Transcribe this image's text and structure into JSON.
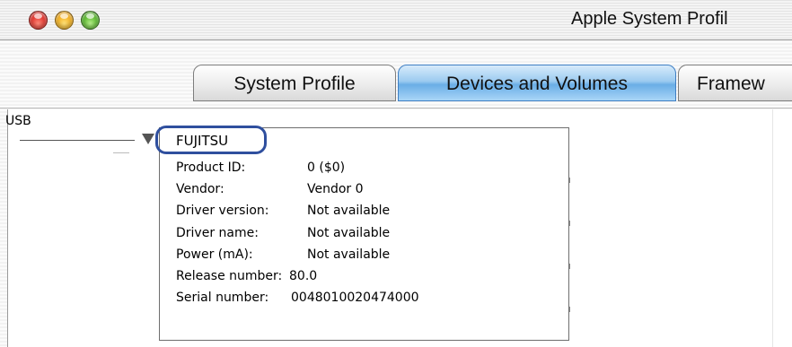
{
  "window": {
    "title": "Apple System Profil"
  },
  "tabs": [
    {
      "label": "System Profile"
    },
    {
      "label": "Devices and Volumes"
    },
    {
      "label": "Framew"
    }
  ],
  "tree": {
    "bus_label": "USB",
    "device": {
      "name": "FUJITSU",
      "properties": [
        {
          "key": "Product ID:",
          "value": "0 ($0)"
        },
        {
          "key": "Vendor:",
          "value": "Vendor 0"
        },
        {
          "key": "Driver version:",
          "value": "Not available"
        },
        {
          "key": "Driver name:",
          "value": "Not available"
        },
        {
          "key": "Power (mA):",
          "value": "Not available"
        },
        {
          "key": "Release number:",
          "value": "80.0"
        },
        {
          "key": "Serial number:",
          "value": "0048010020474000"
        }
      ]
    }
  },
  "colors": {
    "selected_tab": "#6aaee6",
    "highlight_ring": "#2f4f9e"
  },
  "icons": [
    "close-button-icon",
    "minimize-button-icon",
    "zoom-button-icon",
    "disclosure-triangle-icon"
  ]
}
